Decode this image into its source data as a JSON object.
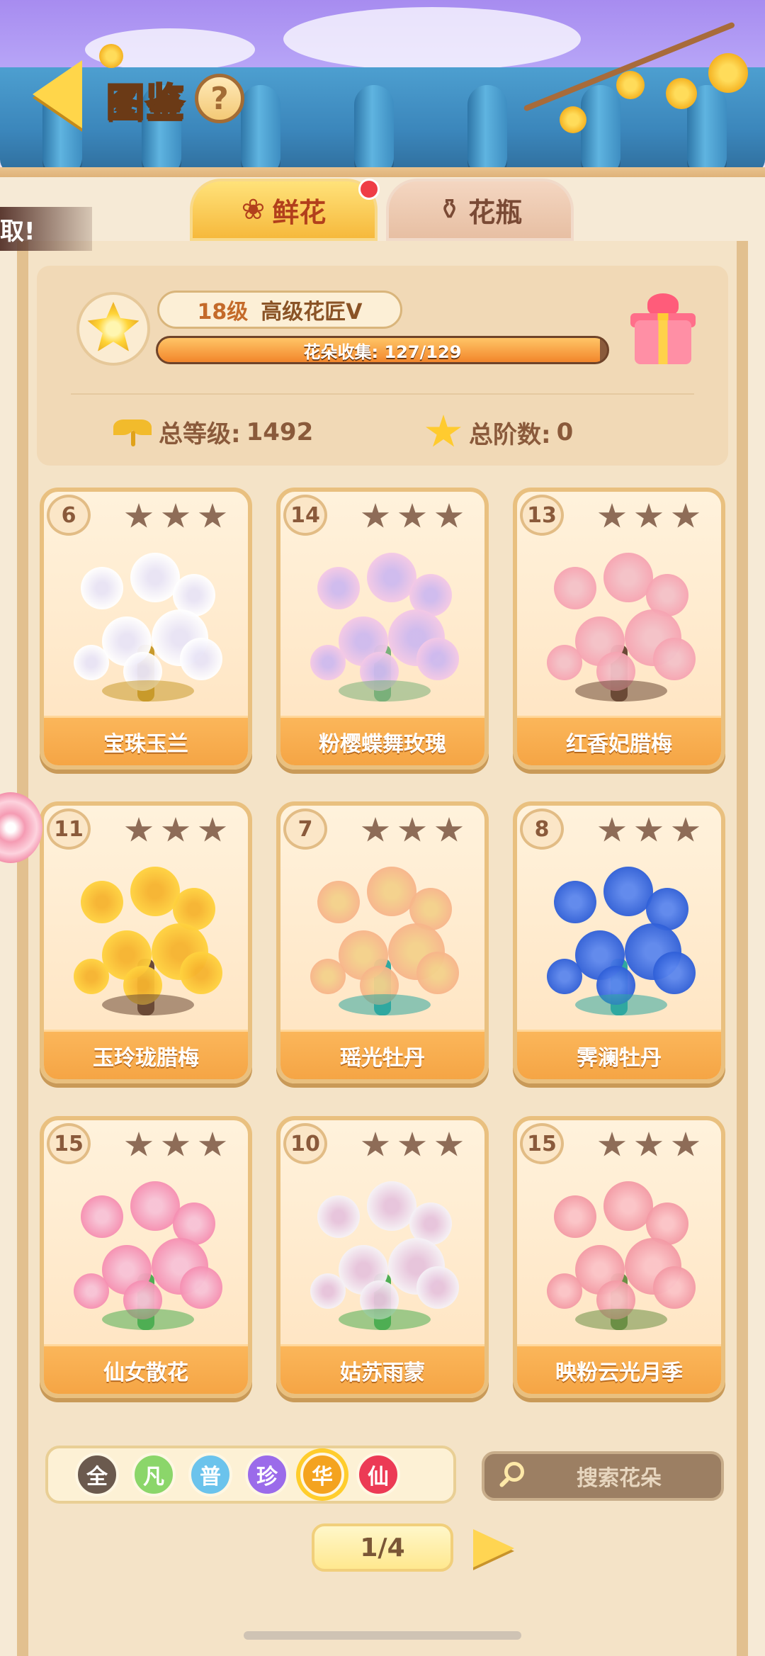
{
  "header": {
    "title": "图鉴",
    "help_label": "?",
    "back_icon": "back-arrow-icon"
  },
  "tabs": [
    {
      "label": "鲜花",
      "icon": "rose-icon",
      "active": true,
      "has_badge": true
    },
    {
      "label": "花瓶",
      "icon": "vase-icon",
      "active": false
    }
  ],
  "side_banner": {
    "text": "取!"
  },
  "summary": {
    "level": "18级",
    "rank": "高级花匠V",
    "collection_label": "花朵收集: 127/129",
    "collection_progress": 0.9845,
    "total_level_label": "总等级:",
    "total_level_value": "1492",
    "total_stage_label": "总阶数:",
    "total_stage_value": "0"
  },
  "cards": [
    {
      "num": "6",
      "name": "宝珠玉兰",
      "stars": 3,
      "colors": [
        "#ffffff",
        "#e8e4f6",
        "#c89a2c"
      ]
    },
    {
      "num": "14",
      "name": "粉樱蝶舞玫瑰",
      "stars": 3,
      "colors": [
        "#f3c8e6",
        "#cdb9ef",
        "#7ab07a"
      ]
    },
    {
      "num": "13",
      "name": "红香妃腊梅",
      "stars": 3,
      "colors": [
        "#f6a4b2",
        "#f3c1c8",
        "#6b4a37"
      ]
    },
    {
      "num": "11",
      "name": "玉玲珑腊梅",
      "stars": 3,
      "colors": [
        "#ffd23e",
        "#f6b32e",
        "#6b4a37"
      ]
    },
    {
      "num": "7",
      "name": "瑶光牡丹",
      "stars": 3,
      "colors": [
        "#f7b58a",
        "#f3d18b",
        "#2fa8a0"
      ]
    },
    {
      "num": "8",
      "name": "霁澜牡丹",
      "stars": 3,
      "colors": [
        "#2f5fd8",
        "#5b86ee",
        "#2fa8a0"
      ]
    },
    {
      "num": "15",
      "name": "仙女散花",
      "stars": 3,
      "colors": [
        "#f58fb2",
        "#f7c2d6",
        "#4fae53"
      ]
    },
    {
      "num": "10",
      "name": "姑苏雨蒙",
      "stars": 3,
      "colors": [
        "#f5f1f6",
        "#e6c3dc",
        "#4fae53"
      ]
    },
    {
      "num": "15",
      "name": "映粉云光月季",
      "stars": 3,
      "colors": [
        "#f39aa5",
        "#fbc3c7",
        "#6b8f45"
      ]
    }
  ],
  "filters": [
    {
      "label": "全",
      "color": "#6b5a4e",
      "selected": false
    },
    {
      "label": "凡",
      "color": "#8bd66a",
      "selected": false
    },
    {
      "label": "普",
      "color": "#6bc3ec",
      "selected": false
    },
    {
      "label": "珍",
      "color": "#9b6bea",
      "selected": false
    },
    {
      "label": "华",
      "color": "#f4a31f",
      "selected": true
    },
    {
      "label": "仙",
      "color": "#ec3a55",
      "selected": false
    }
  ],
  "search": {
    "placeholder": "搜索花朵"
  },
  "pager": {
    "label": "1/4"
  }
}
